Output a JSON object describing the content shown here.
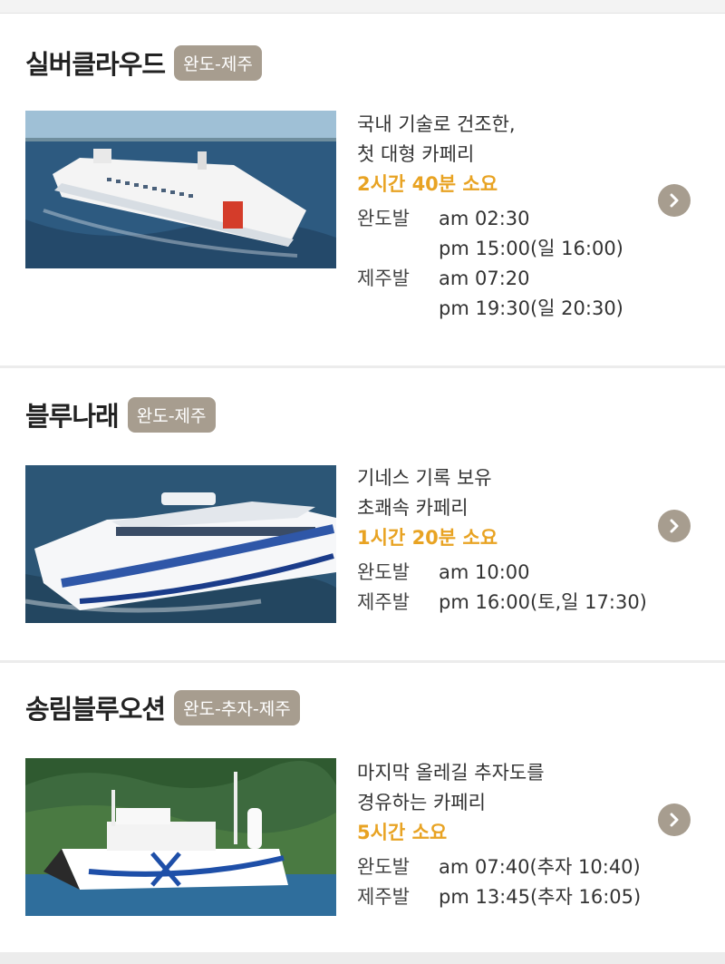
{
  "ferries": [
    {
      "name": "실버클라우드",
      "route": "완도-제주",
      "photo_icon": "ferry-photo",
      "desc": [
        "국내 기술로 건조한,",
        "첫 대형 카페리"
      ],
      "duration": "2시간 40분 소요",
      "schedule": [
        {
          "label": "완도발",
          "times": [
            "am 02:30",
            "pm 15:00(일 16:00)"
          ]
        },
        {
          "label": "제주발",
          "times": [
            "am 07:20",
            "pm 19:30(일 20:30)"
          ]
        }
      ]
    },
    {
      "name": "블루나래",
      "route": "완도-제주",
      "photo_icon": "catamaran-photo",
      "desc": [
        "기네스 기록 보유",
        "초쾌속 카페리"
      ],
      "duration": "1시간 20분 소요",
      "schedule": [
        {
          "label": "완도발",
          "times": [
            "am 10:00"
          ]
        },
        {
          "label": "제주발",
          "times": [
            "pm 16:00(토,일 17:30)"
          ]
        }
      ]
    },
    {
      "name": "송림블루오션",
      "route": "완도-추자-제주",
      "photo_icon": "ferry-photo",
      "desc": [
        "마지막 올레길 추자도를",
        "경유하는 카페리"
      ],
      "duration": "5시간 소요",
      "schedule": [
        {
          "label": "완도발",
          "times": [
            "am 07:40(추자 10:40)"
          ]
        },
        {
          "label": "제주발",
          "times": [
            "pm 13:45(추자 16:05)"
          ]
        }
      ]
    }
  ],
  "colors": {
    "badge": "#a79d8f",
    "duration": "#e8a323",
    "arrow": "#a79d8f"
  }
}
